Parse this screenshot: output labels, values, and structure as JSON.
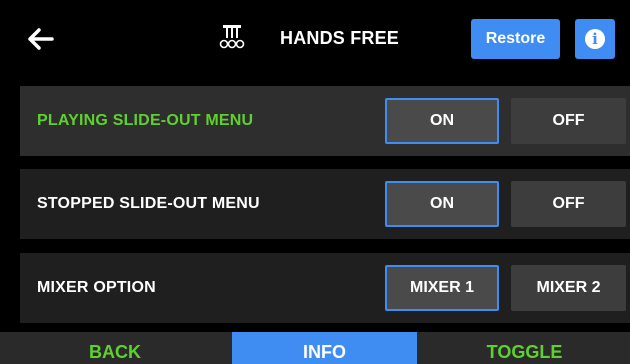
{
  "header": {
    "back_icon": "left-arrow-icon",
    "pedal_icon": "pedal-icon",
    "title": "HANDS FREE",
    "restore_label": "Restore",
    "info_icon": "info-icon"
  },
  "rows": [
    {
      "label": "PLAYING SLIDE-OUT MENU",
      "option1": "ON",
      "option2": "OFF",
      "selected": "option1",
      "active": true
    },
    {
      "label": "STOPPED SLIDE-OUT MENU",
      "option1": "ON",
      "option2": "OFF",
      "selected": "option1",
      "active": false
    },
    {
      "label": "MIXER OPTION",
      "option1": "MIXER 1",
      "option2": "MIXER 2",
      "selected": "option1",
      "active": false
    }
  ],
  "tabs": {
    "back": "BACK",
    "info": "INFO",
    "toggle": "TOGGLE"
  },
  "colors": {
    "accent_blue": "#3f8cf2",
    "active_green": "#5fd12e",
    "background": "#000000",
    "row_bg": "#1f1f1f",
    "row_active_bg": "#2e2e2e"
  }
}
